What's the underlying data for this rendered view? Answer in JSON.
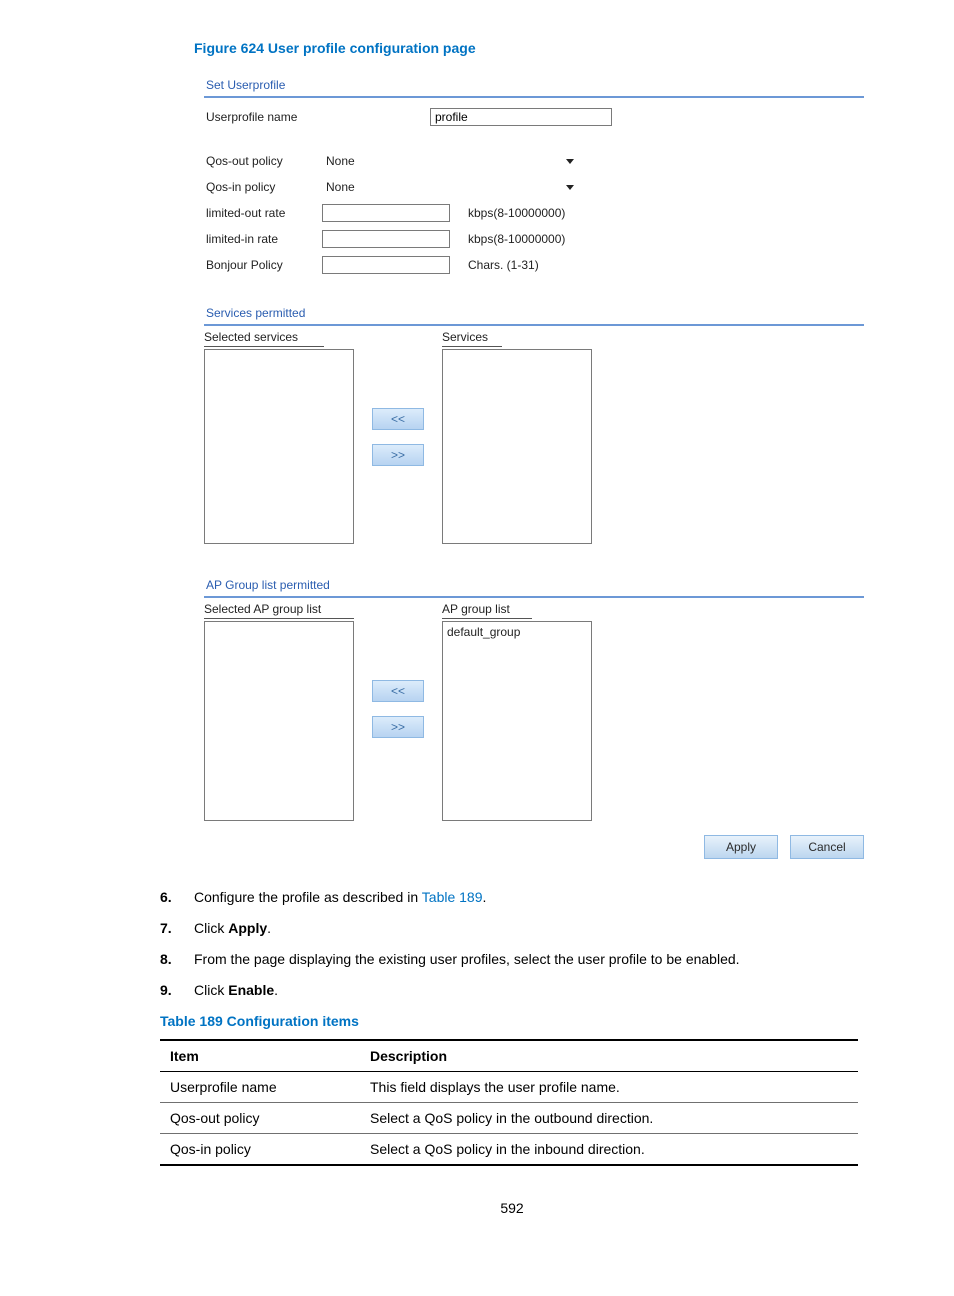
{
  "figure": {
    "title": "Figure 624 User profile configuration page"
  },
  "setUserprofile": {
    "header": "Set Userprofile",
    "fields": {
      "name_label": "Userprofile name",
      "name_value": "profile",
      "qos_out_label": "Qos-out policy",
      "qos_out_value": "None",
      "qos_in_label": "Qos-in policy",
      "qos_in_value": "None",
      "limited_out_label": "limited-out rate",
      "limited_out_unit": "kbps(8-10000000)",
      "limited_in_label": "limited-in rate",
      "limited_in_unit": "kbps(8-10000000)",
      "bonjour_label": "Bonjour Policy",
      "bonjour_unit": "Chars. (1-31)"
    }
  },
  "servicesPermitted": {
    "header": "Services permitted",
    "left_label": "Selected services",
    "right_label": "Services",
    "move_left": "<<",
    "move_right": ">>"
  },
  "apGroupPermitted": {
    "header": "AP Group list permitted",
    "left_label": "Selected AP group list",
    "right_label": "AP group list",
    "items": [
      "default_group"
    ],
    "move_left": "<<",
    "move_right": ">>"
  },
  "buttons": {
    "apply": "Apply",
    "cancel": "Cancel"
  },
  "steps": {
    "s6": {
      "num": "6.",
      "prefix": "Configure the profile as described in ",
      "link": "Table 189",
      "suffix": "."
    },
    "s7": {
      "num": "7.",
      "prefix": "Click ",
      "bold": "Apply",
      "suffix": "."
    },
    "s8": {
      "num": "8.",
      "text": "From the page displaying the existing user profiles, select the user profile to be enabled."
    },
    "s9": {
      "num": "9.",
      "prefix": "Click ",
      "bold": "Enable",
      "suffix": "."
    }
  },
  "table": {
    "title": "Table 189 Configuration items",
    "headers": {
      "item": "Item",
      "desc": "Description"
    },
    "rows": [
      {
        "item": "Userprofile name",
        "desc": "This field displays the user profile name."
      },
      {
        "item": "Qos-out policy",
        "desc": "Select a QoS policy in the outbound direction."
      },
      {
        "item": "Qos-in policy",
        "desc": "Select a QoS policy in the inbound direction."
      }
    ]
  },
  "page_number": "592"
}
